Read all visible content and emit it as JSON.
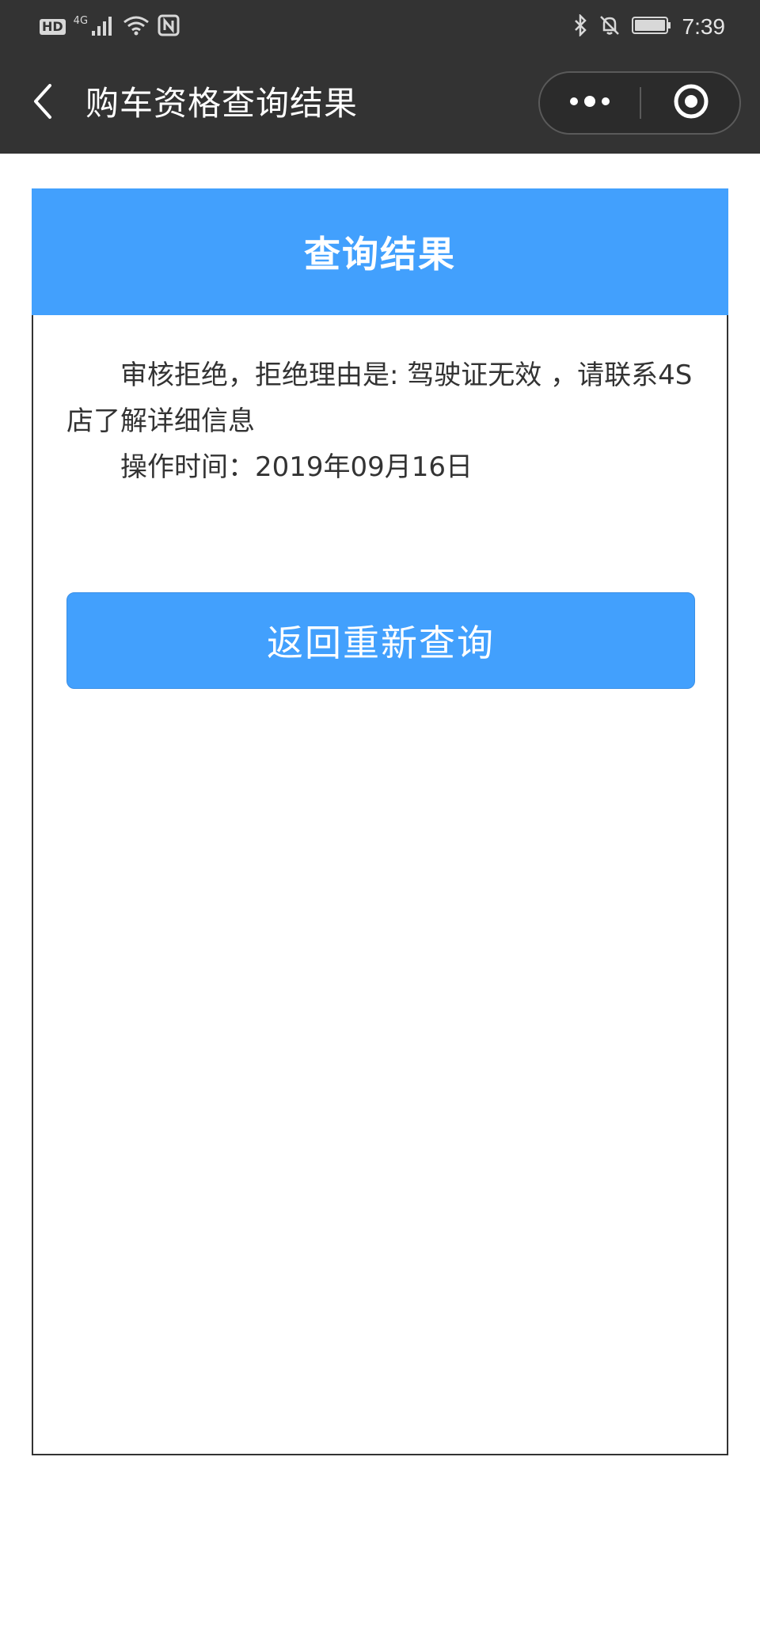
{
  "status_bar": {
    "hd": "HD",
    "network": "4G",
    "time": "7:39"
  },
  "icons": {
    "signal": "signal-icon",
    "wifi": "wifi-icon",
    "nfc": "nfc-icon",
    "bluetooth": "bluetooth-icon",
    "mute": "bell-off-icon",
    "battery": "battery-icon",
    "back": "chevron-left-icon",
    "more": "more-dots-icon",
    "close": "target-close-icon"
  },
  "nav": {
    "title": "购车资格查询结果"
  },
  "card": {
    "title": "查询结果",
    "result_message": "审核拒绝，拒绝理由是: 驾驶证无效 ，请联系4S店了解详细信息",
    "operation_time_label": "操作时间：",
    "operation_time_value": "2019年09月16日",
    "button_label": "返回重新查询"
  },
  "colors": {
    "accent": "#42a0fd",
    "nav_bg": "#333333",
    "text": "#333333"
  }
}
